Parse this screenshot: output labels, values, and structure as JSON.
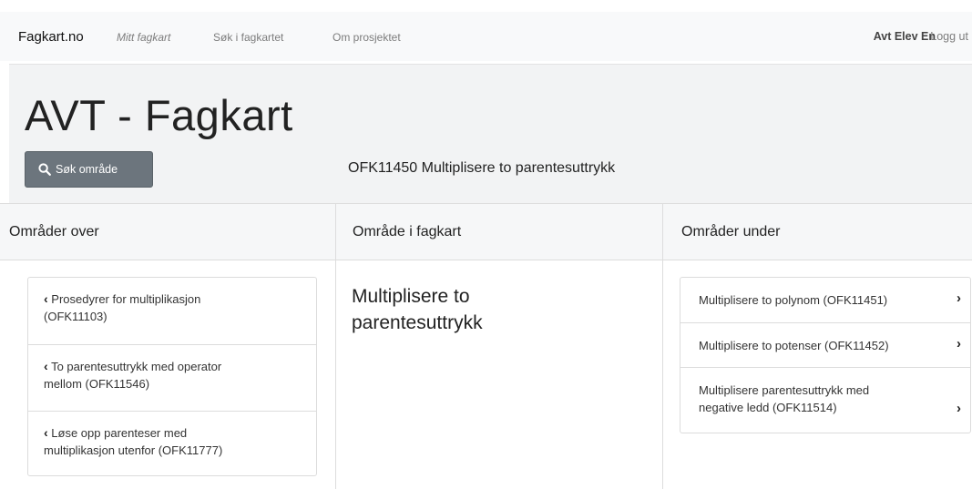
{
  "navbar": {
    "brand": "Fagkart.no",
    "links": [
      "Mitt fagkart",
      "Søk i fagkartet",
      "Om prosjektet"
    ],
    "user": "Avt Elev En",
    "logout": "Logg ut"
  },
  "header": {
    "title": "AVT - Fagkart",
    "search_button": "Søk område",
    "current_area": "OFK11450 Multiplisere to parentesuttrykk"
  },
  "columns": {
    "over": "Områder over",
    "current": "Område i fagkart",
    "under": "Områder under"
  },
  "areas_over": [
    {
      "line1": "Prosedyrer for multiplikasjon",
      "line2": "(OFK11103)"
    },
    {
      "line1": "To parentesuttrykk med operator",
      "line2": "mellom (OFK11546)"
    },
    {
      "line1": "Løse opp parenteser med",
      "line2": "multiplikasjon utenfor (OFK11777)"
    }
  ],
  "current_area_title": {
    "line1": "Multiplisere to",
    "line2": "parentesuttrykk"
  },
  "areas_under": [
    {
      "line1": "Multiplisere to polynom (OFK11451)",
      "line2": ""
    },
    {
      "line1": "Multiplisere to potenser (OFK11452)",
      "line2": ""
    },
    {
      "line1": "Multiplisere parentesuttrykk med",
      "line2": "negative ledd (OFK11514)"
    }
  ]
}
